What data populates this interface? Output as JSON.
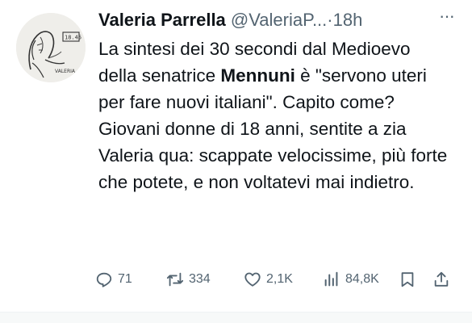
{
  "tweet": {
    "author_name": "Valeria Parrella",
    "handle": "@ValeriaP...",
    "separator": "·",
    "time": "18h",
    "text_parts": {
      "p1": "La sintesi dei 30 secondi dal Medioevo della senatrice ",
      "bold": "Mennuni",
      "p2": " è \"servono uteri per fare nuovi italiani\". Capito come? Giovani donne di 18 anni, sentite a zia Valeria qua: scappate velocissime, più forte che potete, e non voltatevi mai indietro."
    },
    "avatar_sketch_text": {
      "sign": "18.45",
      "signature": "VALERIA"
    },
    "actions": {
      "replies": "71",
      "reposts": "334",
      "likes": "2,1K",
      "views": "84,8K"
    },
    "icons": [
      "more-icon",
      "reply-icon",
      "repost-icon",
      "like-icon",
      "views-icon",
      "bookmark-icon",
      "share-icon"
    ],
    "colors": {
      "text": "#0f1419",
      "secondary": "#536471",
      "background": "#ffffff"
    }
  }
}
